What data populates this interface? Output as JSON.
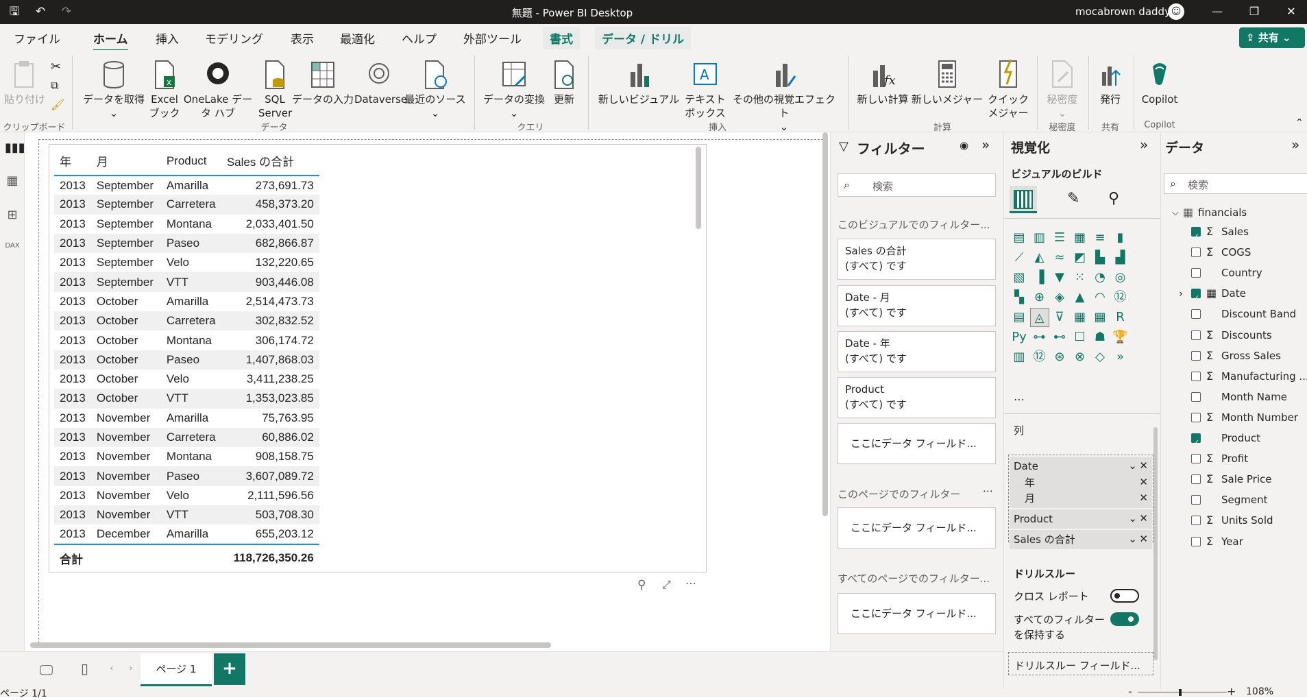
{
  "window": {
    "title": "無題 - Power BI Desktop",
    "user": "mocabrown daddy"
  },
  "menu": {
    "items": [
      "ファイル",
      "ホーム",
      "挿入",
      "モデリング",
      "表示",
      "最適化",
      "ヘルプ",
      "外部ツール"
    ],
    "active": "ホーム",
    "context_tabs": [
      "書式",
      "データ / ドリル"
    ],
    "share": "共有"
  },
  "ribbon": {
    "paste": "貼り付け",
    "get_data": "データを取得",
    "excel": "Excel ブック",
    "onelake": "OneLake データ ハブ",
    "sql": "SQL Server",
    "enter_data": "データの入力",
    "dataverse": "Dataverse",
    "recent": "最近のソース",
    "transform": "データの変換",
    "refresh": "更新",
    "new_visual": "新しいビジュアル",
    "textbox": "テキスト ボックス",
    "more_visuals": "その他の視覚エフェクト",
    "new_calc": "新しい計算",
    "new_measure": "新しいメジャー",
    "quick_measure": "クイック メジャー",
    "sensitivity": "秘密度",
    "publish": "発行",
    "copilot": "Copilot",
    "groups": {
      "clipboard": "クリップボード",
      "data": "データ",
      "query": "クエリ",
      "insert": "挿入",
      "calc": "計算",
      "sensitivity": "秘密度",
      "share": "共有",
      "copilot": "Copilot"
    }
  },
  "table": {
    "headers": [
      "年",
      "月",
      "Product",
      "Sales の合計"
    ],
    "rows": [
      [
        "2013",
        "September",
        "Amarilla",
        "273,691.73"
      ],
      [
        "2013",
        "September",
        "Carretera",
        "458,373.20"
      ],
      [
        "2013",
        "September",
        "Montana",
        "2,033,401.50"
      ],
      [
        "2013",
        "September",
        "Paseo",
        "682,866.87"
      ],
      [
        "2013",
        "September",
        "Velo",
        "132,220.65"
      ],
      [
        "2013",
        "September",
        "VTT",
        "903,446.08"
      ],
      [
        "2013",
        "October",
        "Amarilla",
        "2,514,473.73"
      ],
      [
        "2013",
        "October",
        "Carretera",
        "302,832.52"
      ],
      [
        "2013",
        "October",
        "Montana",
        "306,174.72"
      ],
      [
        "2013",
        "October",
        "Paseo",
        "1,407,868.03"
      ],
      [
        "2013",
        "October",
        "Velo",
        "3,411,238.25"
      ],
      [
        "2013",
        "October",
        "VTT",
        "1,353,023.85"
      ],
      [
        "2013",
        "November",
        "Amarilla",
        "75,763.95"
      ],
      [
        "2013",
        "November",
        "Carretera",
        "60,886.02"
      ],
      [
        "2013",
        "November",
        "Montana",
        "908,158.75"
      ],
      [
        "2013",
        "November",
        "Paseo",
        "3,607,089.72"
      ],
      [
        "2013",
        "November",
        "Velo",
        "2,111,596.56"
      ],
      [
        "2013",
        "November",
        "VTT",
        "503,708.30"
      ],
      [
        "2013",
        "December",
        "Amarilla",
        "655,203.12"
      ]
    ],
    "total_label": "合計",
    "total_value": "118,726,350.26"
  },
  "filters": {
    "title": "フィルター",
    "search": "検索",
    "visual_header": "このビジュアルでのフィルター...",
    "cards": [
      [
        "Sales の合計",
        "(すべて) です"
      ],
      [
        "Date - 月",
        "(すべて) です"
      ],
      [
        "Date - 年",
        "(すべて) です"
      ],
      [
        "Product",
        "(すべて) です"
      ]
    ],
    "add_field": "ここにデータ フィールド...",
    "page_header": "このページでのフィルター",
    "all_header": "すべてのページでのフィルター..."
  },
  "viz": {
    "title": "視覚化",
    "build": "ビジュアルのビルド",
    "columns_label": "列",
    "wells": [
      "Date",
      "年",
      "月",
      "Product",
      "Sales の合計"
    ],
    "drill": "ドリルスルー",
    "cross": "クロス レポート",
    "keep_all_a": "すべてのフィルター",
    "keep_all_b": "を保持する",
    "drill_field": "ドリルスルー フィールド..."
  },
  "data": {
    "title": "データ",
    "search": "検索",
    "table": "financials",
    "fields": [
      {
        "name": "Sales",
        "sigma": true,
        "checked": true
      },
      {
        "name": "COGS",
        "sigma": true,
        "checked": false
      },
      {
        "name": "Country",
        "sigma": false,
        "checked": false
      },
      {
        "name": "Date",
        "sigma": false,
        "checked": true
      },
      {
        "name": "Discount Band",
        "sigma": false,
        "checked": false
      },
      {
        "name": "Discounts",
        "sigma": true,
        "checked": false
      },
      {
        "name": "Gross Sales",
        "sigma": true,
        "checked": false
      },
      {
        "name": "Manufacturing ...",
        "sigma": true,
        "checked": false
      },
      {
        "name": "Month Name",
        "sigma": false,
        "checked": false
      },
      {
        "name": "Month Number",
        "sigma": true,
        "checked": false
      },
      {
        "name": "Product",
        "sigma": false,
        "checked": true
      },
      {
        "name": "Profit",
        "sigma": true,
        "checked": false
      },
      {
        "name": "Sale Price",
        "sigma": true,
        "checked": false
      },
      {
        "name": "Segment",
        "sigma": false,
        "checked": false
      },
      {
        "name": "Units Sold",
        "sigma": true,
        "checked": false
      },
      {
        "name": "Year",
        "sigma": true,
        "checked": false
      }
    ]
  },
  "pages": {
    "tab": "ページ 1",
    "status": "ページ 1/1",
    "zoom": "108%"
  },
  "colors": {
    "accent": "#117865",
    "table_rule": "#118dff"
  }
}
